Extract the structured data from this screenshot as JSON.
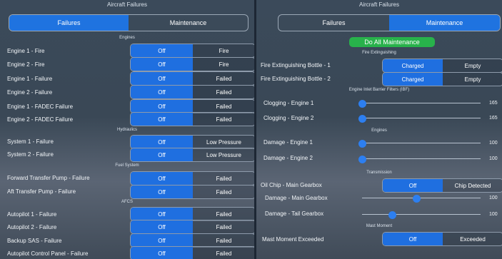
{
  "left": {
    "title": "Aircraft Failures",
    "tabs": [
      {
        "label": "Failures",
        "active": true
      },
      {
        "label": "Maintenance",
        "active": false
      }
    ],
    "sections": {
      "engines": "Engines",
      "hydraulics": "Hydraulics",
      "fuel": "Fuel System",
      "afcs": "AFCS"
    },
    "rows": {
      "e1fire": {
        "label": "Engine 1 - Fire",
        "off": "Off",
        "on": "Fire"
      },
      "e2fire": {
        "label": "Engine 2 - Fire",
        "off": "Off",
        "on": "Fire"
      },
      "e1fail": {
        "label": "Engine 1 - Failure",
        "off": "Off",
        "on": "Failed"
      },
      "e2fail": {
        "label": "Engine 2 - Failure",
        "off": "Off",
        "on": "Failed"
      },
      "e1fadec": {
        "label": "Engine 1 - FADEC Failure",
        "off": "Off",
        "on": "Failed"
      },
      "e2fadec": {
        "label": "Engine 2 - FADEC Failure",
        "off": "Off",
        "on": "Failed"
      },
      "sys1": {
        "label": "System 1 - Failure",
        "off": "Off",
        "on": "Low Pressure"
      },
      "sys2": {
        "label": "System 2 - Failure",
        "off": "Off",
        "on": "Low Pressure"
      },
      "fwdpump": {
        "label": "Forward Transfer Pump - Failure",
        "off": "Off",
        "on": "Failed"
      },
      "aftpump": {
        "label": "Aft Transfer Pump - Failure",
        "off": "Off",
        "on": "Failed"
      },
      "ap1": {
        "label": "Autopilot 1 - Failure",
        "off": "Off",
        "on": "Failed"
      },
      "ap2": {
        "label": "Autopilot 2 - Failure",
        "off": "Off",
        "on": "Failed"
      },
      "sas": {
        "label": "Backup SAS - Failure",
        "off": "Off",
        "on": "Failed"
      },
      "apcp": {
        "label": "Autopilot Control Panel - Failure",
        "off": "Off",
        "on": "Failed"
      }
    }
  },
  "right": {
    "title": "Aircraft Failures",
    "tabs": [
      {
        "label": "Failures",
        "active": false
      },
      {
        "label": "Maintenance",
        "active": true
      }
    ],
    "do_all": "Do All Maintenance",
    "sections": {
      "fire": "Fire Extinguishing",
      "ibf": "Engine Inlet Barrier Filters (IBF)",
      "engines": "Engines",
      "transmission": "Transmission",
      "mast": "Mast Moment"
    },
    "bottle1": {
      "label": "Fire Extinguishing Bottle - 1",
      "left": "Charged",
      "right": "Empty"
    },
    "bottle2": {
      "label": "Fire Extinguishing Bottle - 2",
      "left": "Charged",
      "right": "Empty"
    },
    "clog1": {
      "label": "Clogging - Engine 1",
      "value": "165"
    },
    "clog2": {
      "label": "Clogging - Engine 2",
      "value": "165"
    },
    "dmg1": {
      "label": "Damage - Engine 1",
      "value": "100"
    },
    "dmg2": {
      "label": "Damage - Engine 2",
      "value": "100"
    },
    "oilchip": {
      "label": "Oil Chip - Main Gearbox",
      "left": "Off",
      "right": "Chip Detected"
    },
    "dmgmain": {
      "label": "Damage - Main Gearbox",
      "value": "100"
    },
    "dmgtail": {
      "label": "Damage - Tail Gearbox",
      "value": "100"
    },
    "mast": {
      "label": "Mast Moment Exceeded",
      "left": "Off",
      "right": "Exceeded"
    }
  }
}
